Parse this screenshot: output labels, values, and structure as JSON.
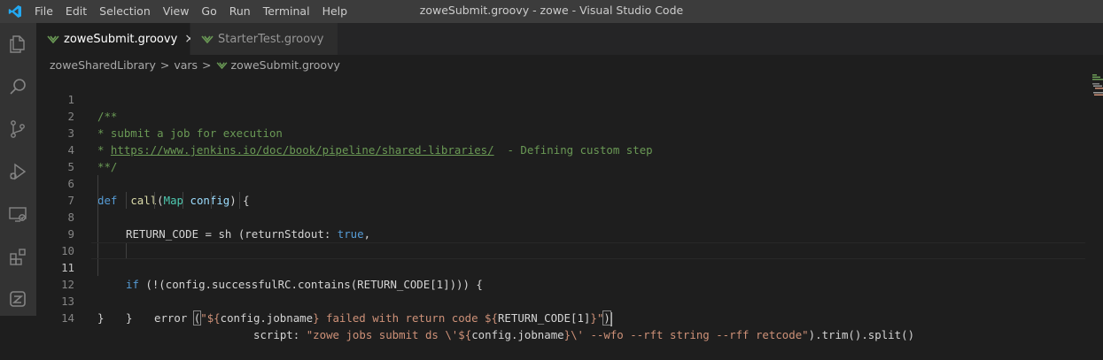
{
  "window": {
    "title": "zoweSubmit.groovy - zowe - Visual Studio Code"
  },
  "menu": [
    "File",
    "Edit",
    "Selection",
    "View",
    "Go",
    "Run",
    "Terminal",
    "Help"
  ],
  "activity_bar": [
    "explorer-icon",
    "search-icon",
    "source-control-icon",
    "run-debug-icon",
    "remote-explorer-icon",
    "extensions-icon",
    "zowe-icon"
  ],
  "tabs": [
    {
      "label": "zoweSubmit.groovy",
      "active": true,
      "close": "×"
    },
    {
      "label": "StarterTest.groovy",
      "active": false
    }
  ],
  "breadcrumb": [
    "zoweSharedLibrary",
    "vars",
    "zoweSubmit.groovy"
  ],
  "breadcrumb_sep": ">",
  "editor": {
    "line_numbers": [
      "1",
      "2",
      "3",
      "4",
      "5",
      "6",
      "7",
      "8",
      "9",
      "10",
      "11",
      "12",
      "13",
      "14"
    ],
    "current_line": 11,
    "tokens": {
      "l1": "/**",
      "l2": "* submit a job for execution",
      "l3_a": "* ",
      "l3_link": "https://www.jenkins.io/doc/book/pipeline/shared-libraries/",
      "l3_b": "  - Defining custom step",
      "l4": "**/",
      "l6_def": "def",
      "l6_call": "call",
      "l6_paren": "(",
      "l6_map": "Map",
      "l6_config": "config",
      "l6_end": ") {",
      "l7_rc": "RETURN_CODE",
      "l7_eq": " = ",
      "l7_sh": "sh",
      "l7_paren": " (",
      "l7_rs": "returnStdout",
      "l7_colon": ": ",
      "l7_true": "true",
      "l7_comma": ",",
      "l8_script": "script",
      "l8_colon": ": ",
      "l8_s1": "\"zowe jobs submit ds \\'${",
      "l8_v1": "config.jobname",
      "l8_s2": "}\\' --wfo --rft string --rff retcode\"",
      "l8_rest_a": ").",
      "l8_trim": "trim",
      "l8_rest_b": "().",
      "l8_split": "split",
      "l8_rest_c": "()",
      "l10_if": "if",
      "l10_a": " (!(",
      "l10_config": "config",
      "l10_dot": ".",
      "l10_src": "successfulRC",
      "l10_dot2": ".",
      "l10_contains": "contains",
      "l10_b": "(",
      "l10_rc": "RETURN_CODE",
      "l10_c": "[1]))) {",
      "l11_error": "error",
      "l11_sp": " ",
      "l11_open": "(",
      "l11_s1": "\"${",
      "l11_v1": "config.jobname",
      "l11_s2": "} failed with return code ${",
      "l11_v2": "RETURN_CODE[1]",
      "l11_s3": "}\"",
      "l11_close": ")",
      "l12": "}",
      "l13": "}"
    }
  },
  "colors": {
    "title_bar": "#3c3c3c",
    "activity_bar": "#333333",
    "editor_bg": "#1e1e1e",
    "comment": "#6a9955",
    "keyword": "#569cd6",
    "string": "#ce9178",
    "function": "#dcdcaa",
    "type": "#4ec9b0",
    "variable": "#9cdcfe",
    "vscode_blue": "#23a9f2",
    "groovy_green": "#6a9955"
  }
}
